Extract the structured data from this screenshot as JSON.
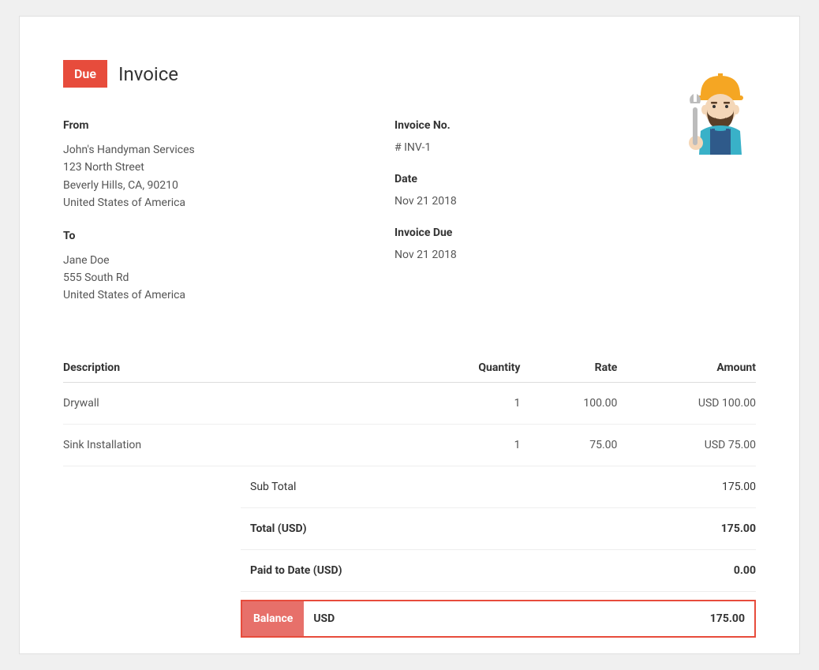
{
  "status": "Due",
  "title": "Invoice",
  "from": {
    "label": "From",
    "name": "John's Handyman Services",
    "street": "123 North Street",
    "city": "Beverly Hills, CA, 90210",
    "country": "United States of America"
  },
  "to": {
    "label": "To",
    "name": "Jane Doe",
    "street": "555 South Rd",
    "country": "United States of America"
  },
  "invoice_no": {
    "label": "Invoice No.",
    "value": "# INV-1"
  },
  "date": {
    "label": "Date",
    "value": "Nov 21 2018"
  },
  "due": {
    "label": "Invoice Due",
    "value": "Nov 21 2018"
  },
  "columns": {
    "description": "Description",
    "quantity": "Quantity",
    "rate": "Rate",
    "amount": "Amount"
  },
  "items": [
    {
      "description": "Drywall",
      "quantity": "1",
      "rate": "100.00",
      "amount": "USD 100.00"
    },
    {
      "description": "Sink Installation",
      "quantity": "1",
      "rate": "75.00",
      "amount": "USD 75.00"
    }
  ],
  "summary": {
    "subtotal": {
      "label": "Sub Total",
      "value": "175.00"
    },
    "total": {
      "label": "Total (USD)",
      "value": "175.00"
    },
    "paid": {
      "label": "Paid to Date (USD)",
      "value": "0.00"
    },
    "balance": {
      "label": "Balance",
      "currency": "USD",
      "value": "175.00"
    }
  }
}
